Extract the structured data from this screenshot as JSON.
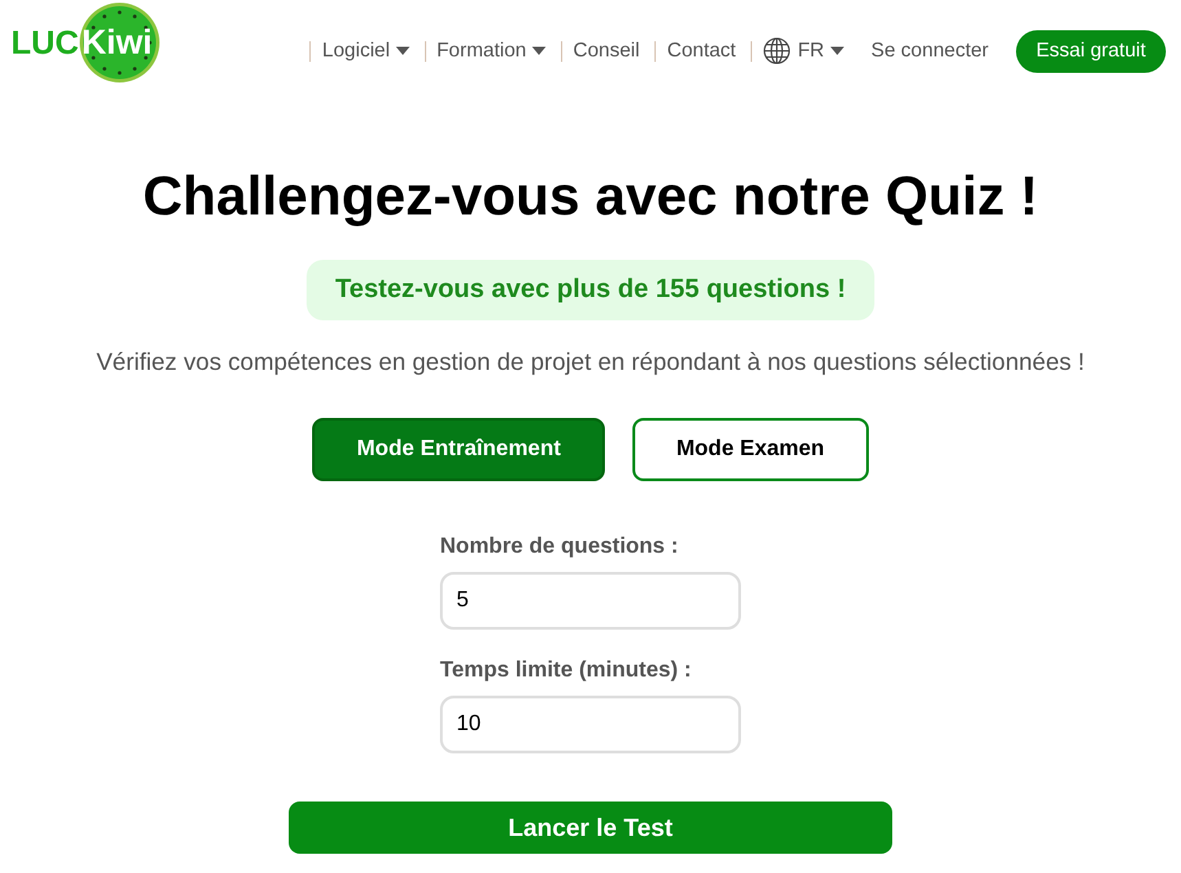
{
  "header": {
    "logo": {
      "part_1": "LUC",
      "part_2": "Kiwi"
    },
    "nav": [
      {
        "label": "Logiciel",
        "dropdown": true
      },
      {
        "label": "Formation",
        "dropdown": true
      },
      {
        "label": "Conseil",
        "dropdown": false
      },
      {
        "label": "Contact",
        "dropdown": false
      }
    ],
    "language": {
      "label": "FR",
      "dropdown": true
    },
    "login": "Se connecter",
    "cta": "Essai gratuit"
  },
  "quiz": {
    "title": "Challengez-vous avec notre Quiz !",
    "badge": "Testez-vous avec plus de 155 questions !",
    "description": "Vérifiez vos compétences en gestion de projet en répondant à nos questions sélectionnées !",
    "modes": [
      {
        "label": "Mode Entraînement",
        "selected": true
      },
      {
        "label": "Mode Examen",
        "selected": false
      }
    ],
    "fields": [
      {
        "label": "Nombre de questions :",
        "value": "5"
      },
      {
        "label": "Temps limite (minutes) :",
        "value": "10"
      }
    ],
    "start_button": "Lancer le Test"
  }
}
